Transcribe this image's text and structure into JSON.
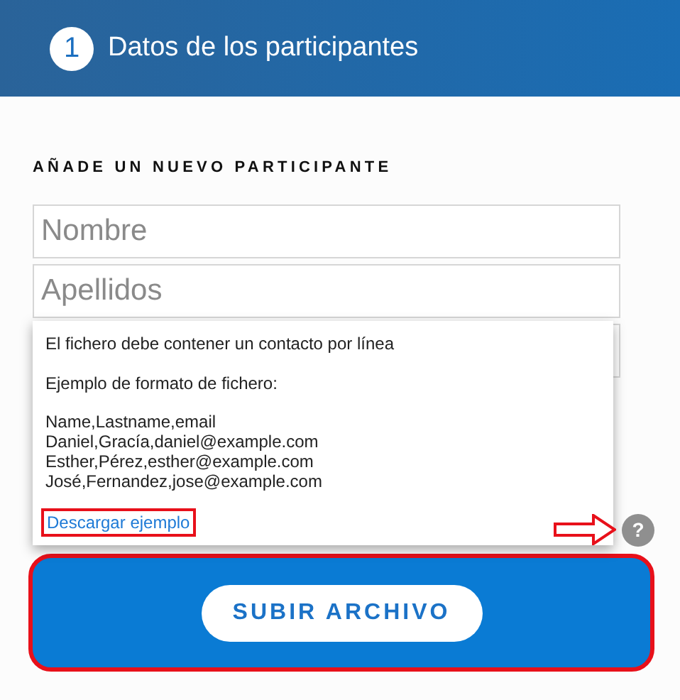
{
  "header": {
    "step": "1",
    "title": "Datos de los participantes"
  },
  "section_title": "AÑADE UN NUEVO PARTICIPANTE",
  "fields": [
    {
      "kind": "text",
      "placeholder": "Nombre"
    },
    {
      "kind": "text",
      "placeholder": "Apellidos"
    },
    {
      "kind": "text"
    }
  ],
  "tooltip": {
    "intro": "El fichero debe contener un contacto por línea",
    "example_title": "Ejemplo de formato de fichero:",
    "example_lines": [
      "Name,Lastname,email",
      "Daniel,Gracía,daniel@example.com",
      "Esther,Pérez,esther@example.com",
      "José,Fernandez,jose@example.com"
    ],
    "link": "Descargar ejemplo",
    "link_highlighted": true
  },
  "help": {
    "symbol": "?",
    "arrow_annotation": true
  },
  "upload": {
    "button": "SUBIR ARCHIVO",
    "highlighted": true
  }
}
